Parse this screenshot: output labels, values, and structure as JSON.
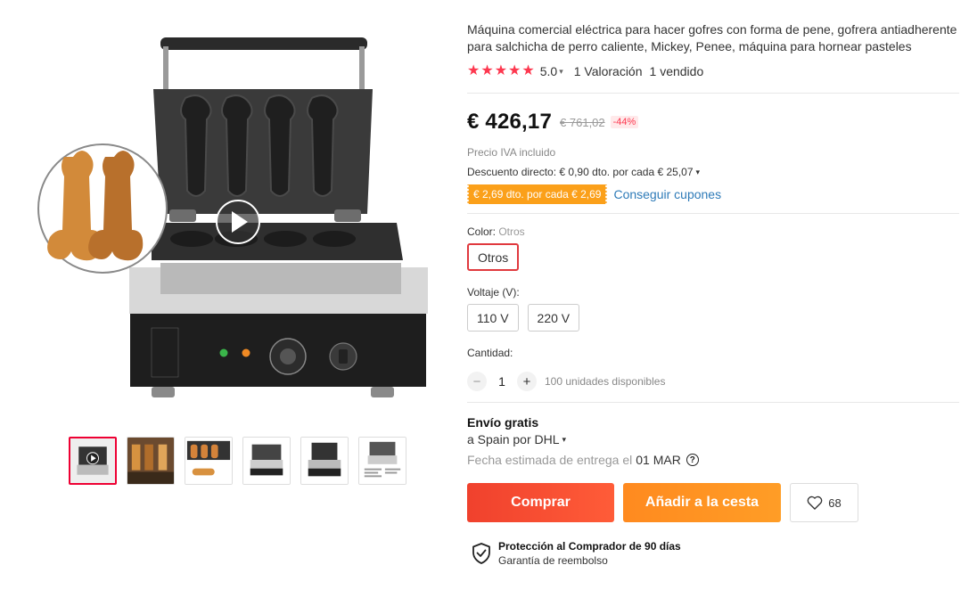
{
  "product": {
    "title": "Máquina comercial eléctrica para hacer gofres con forma de pene, gofrera antiadherente para salchicha de perro caliente, Mickey, Penee, máquina para hornear pasteles",
    "rating": "5.0",
    "rating_stars": 5,
    "reviews": "1 Valoración",
    "sold": "1 vendido"
  },
  "price": {
    "current": "€ 426,17",
    "original": "€ 761,02",
    "discount": "-44%",
    "vat": "Precio IVA incluido",
    "direct_discount": "Descuento directo: € 0,90 dto. por cada € 25,07",
    "coupon": "€ 2,69 dto. por cada € 2,69",
    "coupon_link": "Conseguir cupones"
  },
  "options": {
    "color_label": "Color: ",
    "color_selected": "Otros",
    "colors": [
      "Otros"
    ],
    "voltage_label": "Voltaje (V):",
    "voltages": [
      "110 V",
      "220 V"
    ],
    "quantity_label": "Cantidad:",
    "quantity": "1",
    "stock": "100 unidades disponibles"
  },
  "shipping": {
    "title": "Envío gratis",
    "by": "a Spain por DHL",
    "eta_label": "Fecha estimada de entrega el",
    "eta_date": "01 MAR"
  },
  "actions": {
    "buy": "Comprar",
    "cart": "Añadir a la cesta",
    "wishlist_count": "68"
  },
  "protection": {
    "title": "Protección al Comprador de 90 días",
    "subtitle": "Garantía de reembolso"
  },
  "colors": {
    "accent": "#fd384f",
    "buy": "#f0412d",
    "cart": "#ff9d26",
    "coupon": "#fba01a",
    "link": "#2e7bb8"
  },
  "icons": [
    "play-icon",
    "star-icon",
    "chevron-down-icon",
    "question-icon",
    "heart-icon",
    "shield-check-icon"
  ]
}
